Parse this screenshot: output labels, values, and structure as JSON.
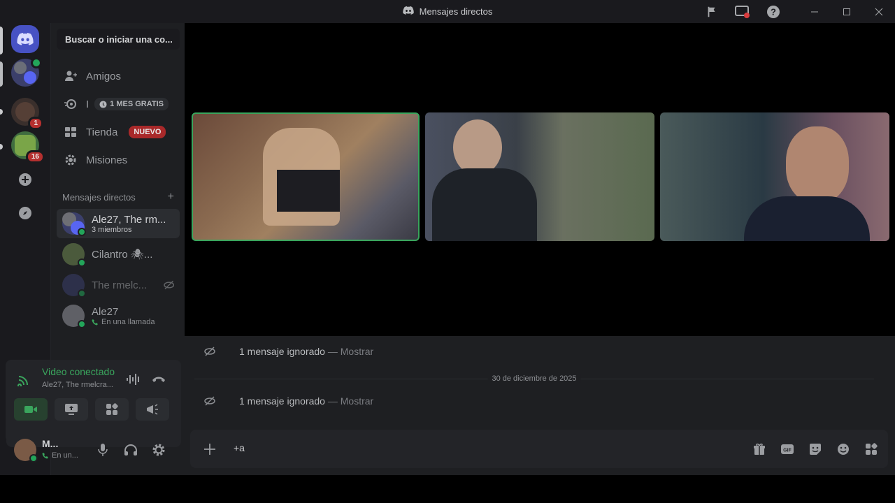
{
  "window": {
    "title": "Mensajes directos"
  },
  "colors": {
    "accent_green": "#23a55a",
    "badge_red": "#b5302f",
    "blurple": "#5865f2"
  },
  "sidebar": {
    "search_placeholder": "Buscar o iniciar una co...",
    "nav": [
      {
        "label": "Amigos",
        "icon": "friends-icon"
      },
      {
        "label": "I",
        "tag": "1 MES GRATIS",
        "icon": "nitro-icon"
      },
      {
        "label": "Tienda",
        "tag": "NUEVO",
        "icon": "shop-icon"
      },
      {
        "label": "Misiones",
        "icon": "quests-icon"
      }
    ],
    "dm_header": "Mensajes directos",
    "dms": [
      {
        "name": "Ale27, The rm...",
        "sub": "3 miembros"
      },
      {
        "name": "Cilantro 🕷...",
        "sub": ""
      },
      {
        "name": "The rmelc...",
        "sub": ""
      },
      {
        "name": "Ale27",
        "sub": "En una llamada"
      }
    ]
  },
  "servers": [
    {
      "name": "home",
      "badge": ""
    },
    {
      "name": "group",
      "badge": ""
    },
    {
      "name": "server-1",
      "badge": "1"
    },
    {
      "name": "server-2",
      "badge": "16"
    }
  ],
  "voice": {
    "status": "Video conectado",
    "channel": "Ale27, The rmelcra..."
  },
  "user": {
    "name": "M...",
    "status": "En un..."
  },
  "chat": {
    "messages": [
      {
        "text": "1 mensaje ignorado",
        "sep": " — ",
        "action": "Mostrar"
      },
      {
        "text": "1 mensaje ignorado",
        "sep": " — ",
        "action": "Mostrar"
      }
    ],
    "date_divider": "30 de diciembre de 2025",
    "composer_value": "+a"
  }
}
